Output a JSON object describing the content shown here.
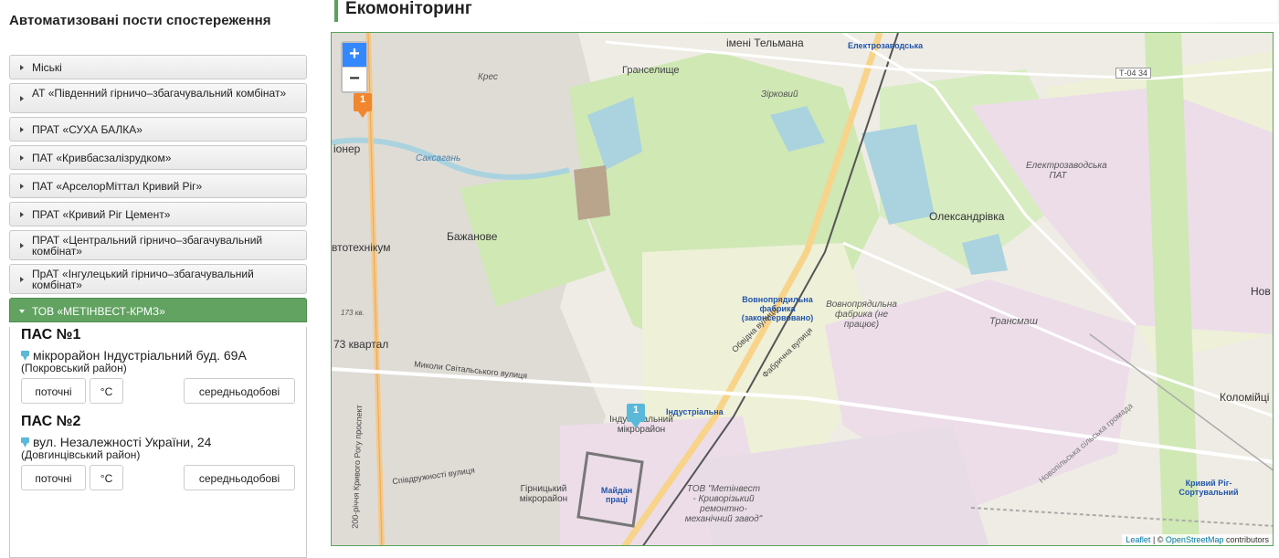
{
  "sidebar": {
    "heading": "Автоматизовані пости спостереження",
    "items": [
      {
        "label": "Міські"
      },
      {
        "label": "АТ «Південний гірничо–збагачувальний комбінат»"
      },
      {
        "label": "ПРАТ «СУХА БАЛКА»"
      },
      {
        "label": "ПАТ «Кривбасзалізрудком»"
      },
      {
        "label": "ПАТ «АрселорМіттал Кривий Ріг»"
      },
      {
        "label": "ПРАТ «Кривий Ріг Цемент»"
      },
      {
        "label": "ПРАТ «Центральний гірничо–збагачувальний комбінат»"
      },
      {
        "label": "ПрАТ «Інгулецький гірничо–збагачувальний комбінат»"
      },
      {
        "label": "ТОВ «МЕТІНВЕСТ-КРМЗ»"
      }
    ],
    "stations": [
      {
        "title": "ПАС №1",
        "address": "мікрорайон Індустріальний буд. 69А",
        "district": "(Покровський район)"
      },
      {
        "title": "ПАС №2",
        "address": "вул. Незалежності України, 24",
        "district": "(Довгинцівський район)"
      }
    ],
    "buttons": {
      "current": "поточні",
      "temp": "°C",
      "daily": "середньодобові"
    }
  },
  "page": {
    "title": "Екомоніторинг"
  },
  "map": {
    "zoom_in": "+",
    "zoom_out": "−",
    "attribution": {
      "leaflet": "Leaflet",
      "sep": " | © ",
      "osm": "OpenStreetMap",
      "contrib": " contributors"
    },
    "markers": [
      {
        "label": "1",
        "color": "#f0862e"
      },
      {
        "label": "1",
        "color": "#5bb8d8"
      }
    ],
    "labels": {
      "telmana": "імені Тельмана",
      "elektrozavodska": "Електрозаводська",
      "t0434": "Т-04 34",
      "kres": "Крес",
      "granselyshche": "Гранселище",
      "zirkovyi": "Зірковий",
      "ioner": "іонер",
      "saksahan": "Саксагань",
      "elektrozavodska_pat": "Електрозаводська ПАТ",
      "oleksandrivka": "Олександрівка",
      "bazhanove": "Бажанове",
      "avtotekhnikum": "втотехнікум",
      "vovnopriadylna": "Вовнопрядильна фабрика (законсервовано)",
      "vovnopriadylna_it": "Вовнопрядильна фабрика (не працює)",
      "transmash": "Трансмаш",
      "kvartal": "73 квартал",
      "mykoly": "Миколи Світальського вулиця",
      "industrialnyi": "Індустріальний мікрорайон",
      "industrialna": "Індустріальна",
      "hirnytskyi": "Гірницький мікрорайон",
      "maidan": "Майдан праці",
      "metinvest": "ТОВ \"Метінвест - Криворізький ремонтно-механічний завод\"",
      "kolomiits": "Коломійці",
      "nov": "Нов",
      "kryvyi": "Кривий Ріг-Сортувальний",
      "obvodna": "Обвідна вулиця",
      "fabrychna": "Фабрична вулиця",
      "prospekt": "200-річчя Кривого Рогу проспект",
      "spivdruzhnosti": "Співдружності вулиця",
      "novopilska": "Новопільська сільська громада",
      "v173": "173 кв."
    }
  }
}
